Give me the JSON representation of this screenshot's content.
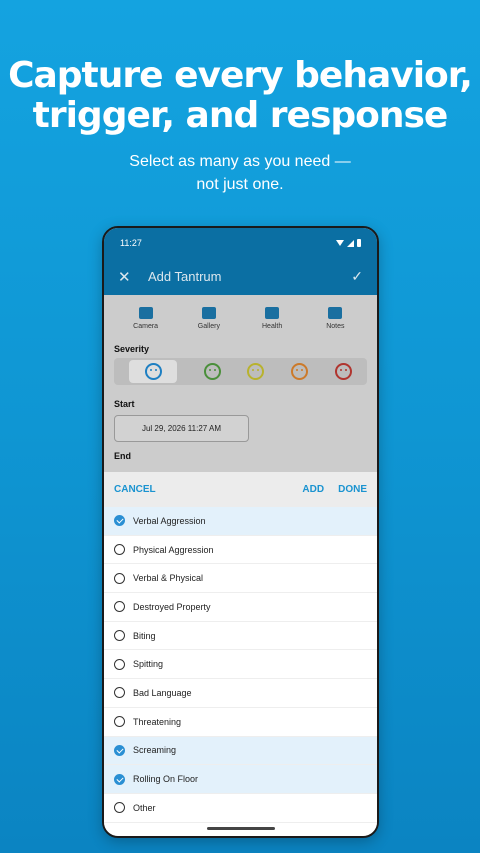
{
  "headline": {
    "line1": "Capture every behavior,",
    "line2": "trigger, and response",
    "sub1": "Select as many as you need —",
    "sub2": "not just one."
  },
  "status": {
    "time": "11:27"
  },
  "appbar": {
    "title": "Add Tantrum"
  },
  "actions": [
    {
      "label": "Camera",
      "icon": "camera-icon"
    },
    {
      "label": "Gallery",
      "icon": "gallery-icon"
    },
    {
      "label": "Health",
      "icon": "heart-pulse-icon"
    },
    {
      "label": "Notes",
      "icon": "note-icon"
    }
  ],
  "form": {
    "severity_label": "Severity",
    "start_label": "Start",
    "start_value": "Jul 29, 2026 11:27 AM",
    "end_label": "End"
  },
  "sheet": {
    "cancel": "CANCEL",
    "add": "ADD",
    "done": "DONE",
    "items": [
      {
        "label": "Verbal Aggression",
        "checked": true
      },
      {
        "label": "Physical Aggression",
        "checked": false
      },
      {
        "label": "Verbal & Physical",
        "checked": false
      },
      {
        "label": "Destroyed Property",
        "checked": false
      },
      {
        "label": "Biting",
        "checked": false
      },
      {
        "label": "Spitting",
        "checked": false
      },
      {
        "label": "Bad Language",
        "checked": false
      },
      {
        "label": "Threatening",
        "checked": false
      },
      {
        "label": "Screaming",
        "checked": true
      },
      {
        "label": "Rolling On Floor",
        "checked": true
      },
      {
        "label": "Other",
        "checked": false
      }
    ]
  },
  "colors": {
    "accent": "#1a93d0",
    "appbar": "#0b6fa3",
    "background": "#0f96d3"
  }
}
